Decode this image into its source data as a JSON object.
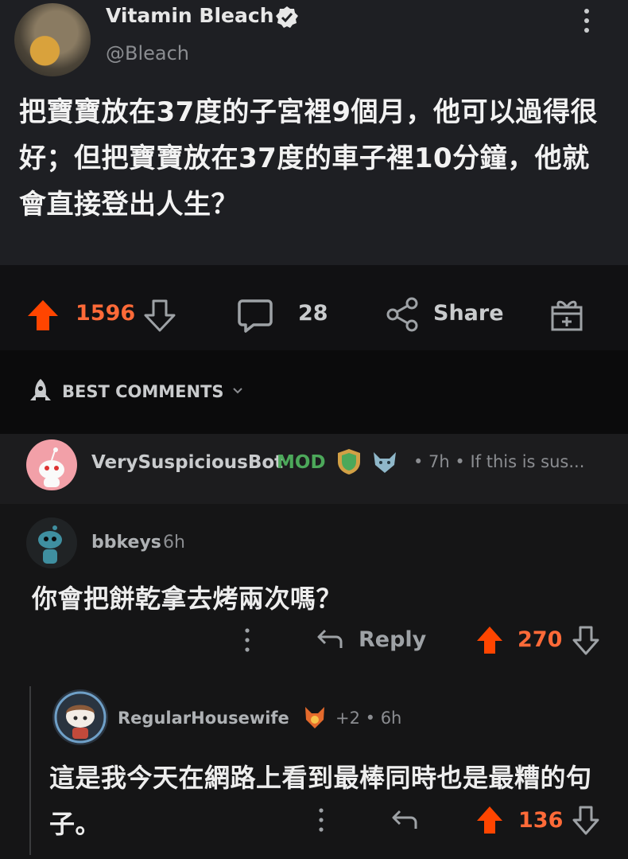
{
  "tweet": {
    "name": "Vitamin Bleach",
    "handle": "@Bleach",
    "text": "把寶寶放在37度的子宮裡9個月，他可以過得很好；但把寶寶放在37度的車子裡10分鐘，他就會直接登出人生？"
  },
  "post_actions": {
    "upvotes": "1596",
    "comments": "28",
    "share_label": "Share"
  },
  "comments_header": {
    "label": "BEST COMMENTS"
  },
  "pinned_comment": {
    "user": "VerySuspiciousBot",
    "mod_label": "MOD",
    "meta": "• 7h • If this is sus..."
  },
  "comment1": {
    "user": "bbkeys",
    "time": "6h",
    "text": "你會把餅乾拿去烤兩次嗎？",
    "reply_label": "Reply",
    "votes": "270"
  },
  "comment2": {
    "user": "RegularHousewife",
    "meta": "+2 • 6h",
    "text": "這是我今天在網路上看到最棒同時也是最糟的句子。",
    "votes": "136"
  },
  "colors": {
    "upvote": "#ff4500",
    "mod": "#4ca85a",
    "background": "#0b0b0c",
    "tweet_bg": "#1e1f23"
  },
  "icons": [
    "verified-badge-icon",
    "more-vertical-icon",
    "upvote-icon",
    "downvote-icon",
    "comment-icon",
    "share-icon",
    "gift-icon",
    "best-rocket-icon",
    "chevron-down-icon",
    "reply-icon"
  ]
}
